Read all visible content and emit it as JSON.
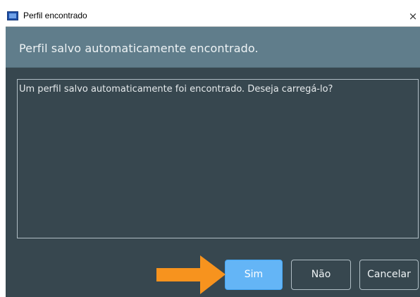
{
  "window": {
    "title": "Perfil encontrado",
    "close_label": "×"
  },
  "header": {
    "text": "Perfil salvo automaticamente encontrado."
  },
  "message": {
    "text": "Um perfil salvo automaticamente foi encontrado. Deseja carregá-lo?"
  },
  "buttons": {
    "yes": "Sim",
    "no": "Não",
    "cancel": "Cancelar"
  },
  "colors": {
    "accent": "#64b5f6",
    "background": "#37474f",
    "header": "#607d8b",
    "arrow": "#f7931e"
  },
  "annotation": {
    "icon": "arrow-right-icon"
  }
}
